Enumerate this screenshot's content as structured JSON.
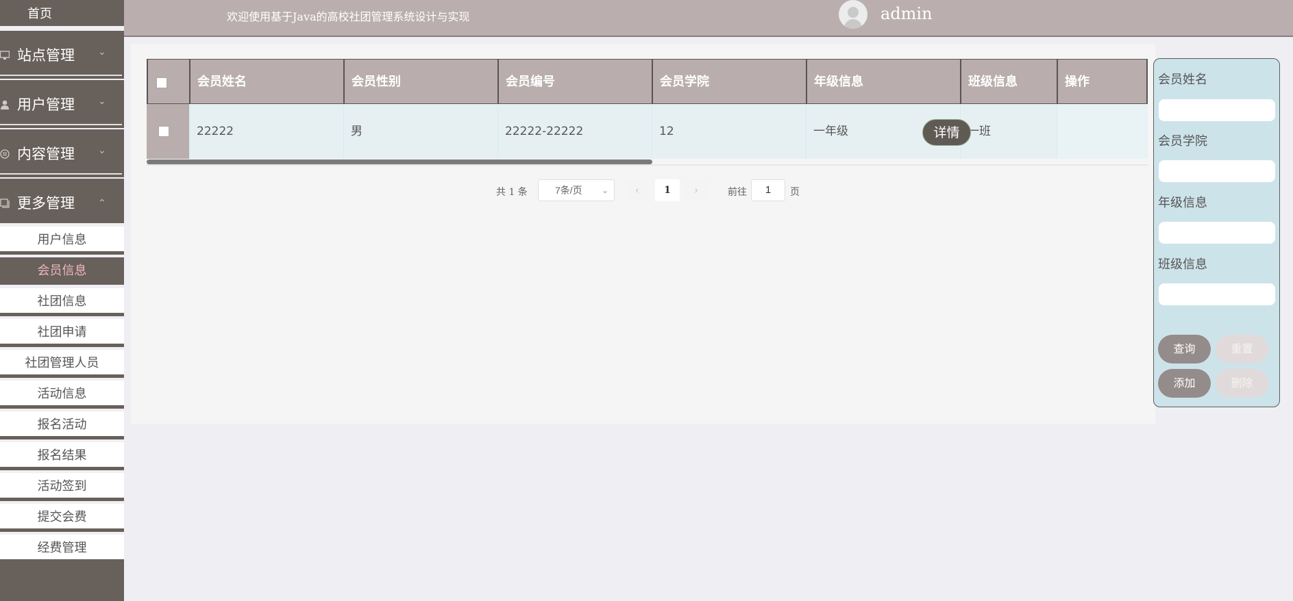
{
  "sidebar": {
    "home": "首页",
    "groups": [
      {
        "label": "站点管理",
        "icon": "monitor-icon"
      },
      {
        "label": "用户管理",
        "icon": "user-icon"
      },
      {
        "label": "内容管理",
        "icon": "content-icon"
      },
      {
        "label": "更多管理",
        "icon": "more-icon"
      }
    ],
    "items": [
      {
        "label": "用户信息"
      },
      {
        "label": "会员信息"
      },
      {
        "label": "社团信息"
      },
      {
        "label": "社团申请"
      },
      {
        "label": "社团管理人员"
      },
      {
        "label": "活动信息"
      },
      {
        "label": "报名活动"
      },
      {
        "label": "报名结果"
      },
      {
        "label": "活动签到"
      },
      {
        "label": "提交会费"
      },
      {
        "label": "经费管理"
      }
    ],
    "active_item": "会员信息"
  },
  "header": {
    "title": "欢迎使用基于Java的高校社团管理系统设计与实现",
    "username": "admin"
  },
  "table": {
    "columns": [
      "会员姓名",
      "会员性别",
      "会员编号",
      "会员学院",
      "年级信息",
      "班级信息",
      "操作"
    ],
    "rows": [
      {
        "name": "22222",
        "gender": "男",
        "number": "22222-22222",
        "college": "12",
        "grade": "一年级",
        "class": "一班",
        "action": "详情"
      }
    ]
  },
  "pagination": {
    "total": "共 1 条",
    "page_size": "7条/页",
    "current_page": "1",
    "goto_label": "前往",
    "goto_value": "1",
    "page_suffix": "页"
  },
  "search": {
    "fields": [
      {
        "label": "会员姓名",
        "value": ""
      },
      {
        "label": "会员学院",
        "value": ""
      },
      {
        "label": "年级信息",
        "value": ""
      },
      {
        "label": "班级信息",
        "value": ""
      }
    ],
    "buttons": {
      "query": "查询",
      "reset": "重置",
      "add": "添加",
      "delete": "删除"
    }
  },
  "colors": {
    "sidebar_bg": "#67605b",
    "header_bg": "#bbaeae",
    "active_text": "#efb6bd",
    "table_header_bg": "#b9adad",
    "row_bg": "#e6f0f2",
    "search_panel_bg": "#cde3ea"
  }
}
